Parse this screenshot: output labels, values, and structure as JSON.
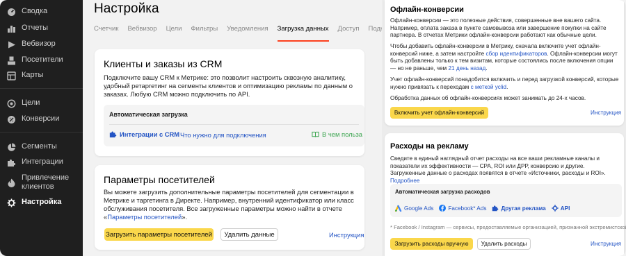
{
  "sidebar": {
    "items": [
      {
        "label": "Сводка",
        "icon": "dashboard-icon"
      },
      {
        "label": "Отчеты",
        "icon": "bar-chart-icon"
      },
      {
        "label": "Вебвизор",
        "icon": "play-icon"
      },
      {
        "label": "Посетители",
        "icon": "person-icon"
      },
      {
        "label": "Карты",
        "icon": "map-icon"
      },
      {
        "label": "Цели",
        "icon": "target-icon"
      },
      {
        "label": "Конверсии",
        "icon": "conversion-icon"
      },
      {
        "label": "Сегменты",
        "icon": "pie-icon"
      },
      {
        "label": "Интеграции",
        "icon": "puzzle-icon"
      },
      {
        "label": "Привлечение клиентов",
        "icon": "flame-icon"
      },
      {
        "label": "Настройка",
        "icon": "gear-icon"
      }
    ]
  },
  "main": {
    "title": "Настройка",
    "tabs": [
      "Счетчик",
      "Вебвизор",
      "Цели",
      "Фильтры",
      "Уведомления",
      "Загрузка данных",
      "Доступ",
      "Подключ"
    ],
    "active_tab": "Загрузка данных",
    "crm": {
      "title": "Клиенты и заказы из CRM",
      "text": "Подключите вашу CRM к Метрике: это позволит настроить сквозную аналитику, удобный ретаргетинг на сегменты клиентов и оптимизацию рекламы по данным о заказах. Любую CRM можно подключить по API.",
      "auto_title": "Автоматическая загрузка",
      "integrations_link": "Интеграции с CRM",
      "requirements_link": "Что нужно для подключения",
      "benefit_link": "В чем польза"
    },
    "visitors": {
      "title": "Параметры посетителей",
      "text_before": "Вы можете загрузить дополнительные параметры посетителей для сегментации в Метрике и таргетинга в Директе. Например, внутренний идентификатор или класс обслуживания посетителя. Все загруженные параметры можно найти в отчете «",
      "report_link": "Параметры посетителей",
      "text_after": "».",
      "upload_button": "Загрузить параметры посетителей",
      "delete_button": "Удалить данные",
      "instruction_link": "Инструкция"
    }
  },
  "offline": {
    "title": "Офлайн-конверсии",
    "p1": "Офлайн-конверсии — это полезные действия, совершенные вне вашего сайта. Например, оплата заказа в пункте самовывоза или завершение покупки на сайте партнера. В отчетах Метрики офлайн-конверсии работают как обычные цели.",
    "p2_a": "Чтобы добавить офлайн-конверсии в Метрику, сначала включите учет офлайн-конверсий ниже, а затем настройте ",
    "p2_link1": "сбор идентификаторов",
    "p2_b": ". Офлайн-конверсии могут быть добавлены только к тем визитам, которые состоялись после включения опции — но не раньше, чем ",
    "p2_link2": "21 день назад",
    "p2_c": ".",
    "p3_a": "Учет офлайн-конверсий понадобится включить и перед загрузкой конверсий, которые нужно привязать к переходам ",
    "p3_link": "с меткой yclid",
    "p3_b": ".",
    "p4": "Обработка данных об офлайн-конверсиях может занимать до 24-х часов.",
    "enable_button": "Включить учет офлайн-конверсий",
    "instruction_link": "Инструкция"
  },
  "ad_costs": {
    "title": "Расходы на рекламу",
    "text_a": "Сведите в единый наглядный отчет расходы на все ваши рекламные каналы и показатели их эффективности — CPA, ROI или ДРР, конверсию и другие. Загруженные данные о расходах появятся в отчете «Источники, расходы и ROI». ",
    "more_link": "Подробнее",
    "auto_title": "Автоматическая загрузка расходов",
    "sources": [
      "Google Ads",
      "Facebook* Ads",
      "Другая реклама",
      "API"
    ],
    "footnote": "* Facebook / Instagram — сервисы, предоставляемые организацией, признанной экстремистской",
    "upload_button": "Загрузить расходы вручную",
    "delete_button": "Удалить расходы",
    "instruction_link": "Инструкция"
  },
  "colors": {
    "accent": "#fc3f1d",
    "button_yellow": "#fad74b",
    "link": "#2354c4",
    "sidebar": "#1f1f1f",
    "benefit": "#3ca550"
  }
}
